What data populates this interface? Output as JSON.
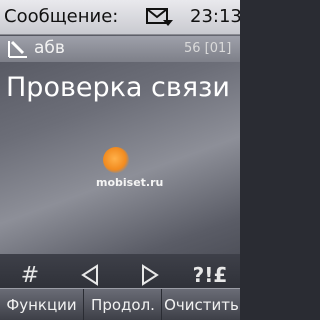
{
  "statusbar": {
    "title": "Сообщение:",
    "icon": "message-envelope-icon",
    "time": "23:13"
  },
  "infobar": {
    "icon": "pen-icon",
    "recipient": "абв",
    "counter": "56 [01]"
  },
  "message": {
    "text": "Проверка связи"
  },
  "watermark": "mobiset.ru",
  "toolbar": {
    "hash_label": "#",
    "left_icon": "arrow-left-icon",
    "right_icon": "arrow-right-icon",
    "symbols_label": "?!£"
  },
  "softkeys": {
    "left": "Функции",
    "middle": "Продол.",
    "right": "Очистить"
  }
}
